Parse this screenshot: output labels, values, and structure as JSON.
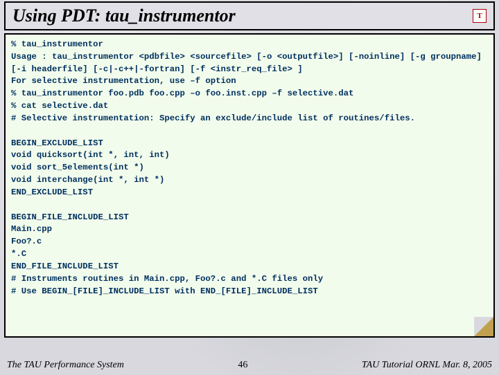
{
  "title": "Using PDT: tau_instrumentor",
  "logo_label": "T",
  "code": {
    "l1": "% tau_instrumentor",
    "l2": "Usage : tau_instrumentor <pdbfile> <sourcefile> [-o <outputfile>] [-noinline] [-g groupname] [-i headerfile] [-c|-c++|-fortran] [-f <instr_req_file> ]",
    "l3": "For selective instrumentation, use –f option",
    "l4": "% tau_instrumentor foo.pdb foo.cpp –o foo.inst.cpp –f selective.dat",
    "l5": "% cat selective.dat",
    "l6": "# Selective instrumentation: Specify an exclude/include list of routines/files.",
    "l7": "",
    "l8": "BEGIN_EXCLUDE_LIST",
    "l9": "void quicksort(int *, int, int)",
    "l10": "void sort_5elements(int *)",
    "l11": "void interchange(int *, int *)",
    "l12": "END_EXCLUDE_LIST",
    "l13": "",
    "l14": "BEGIN_FILE_INCLUDE_LIST",
    "l15": "Main.cpp",
    "l16": "Foo?.c",
    "l17": "*.C",
    "l18": "END_FILE_INCLUDE_LIST",
    "l19": "# Instruments routines in Main.cpp, Foo?.c and *.C files only",
    "l20": "# Use BEGIN_[FILE]_INCLUDE_LIST with END_[FILE]_INCLUDE_LIST"
  },
  "footer": {
    "left": "The TAU Performance System",
    "center": "46",
    "right": "TAU Tutorial ORNL Mar. 8, 2005"
  }
}
